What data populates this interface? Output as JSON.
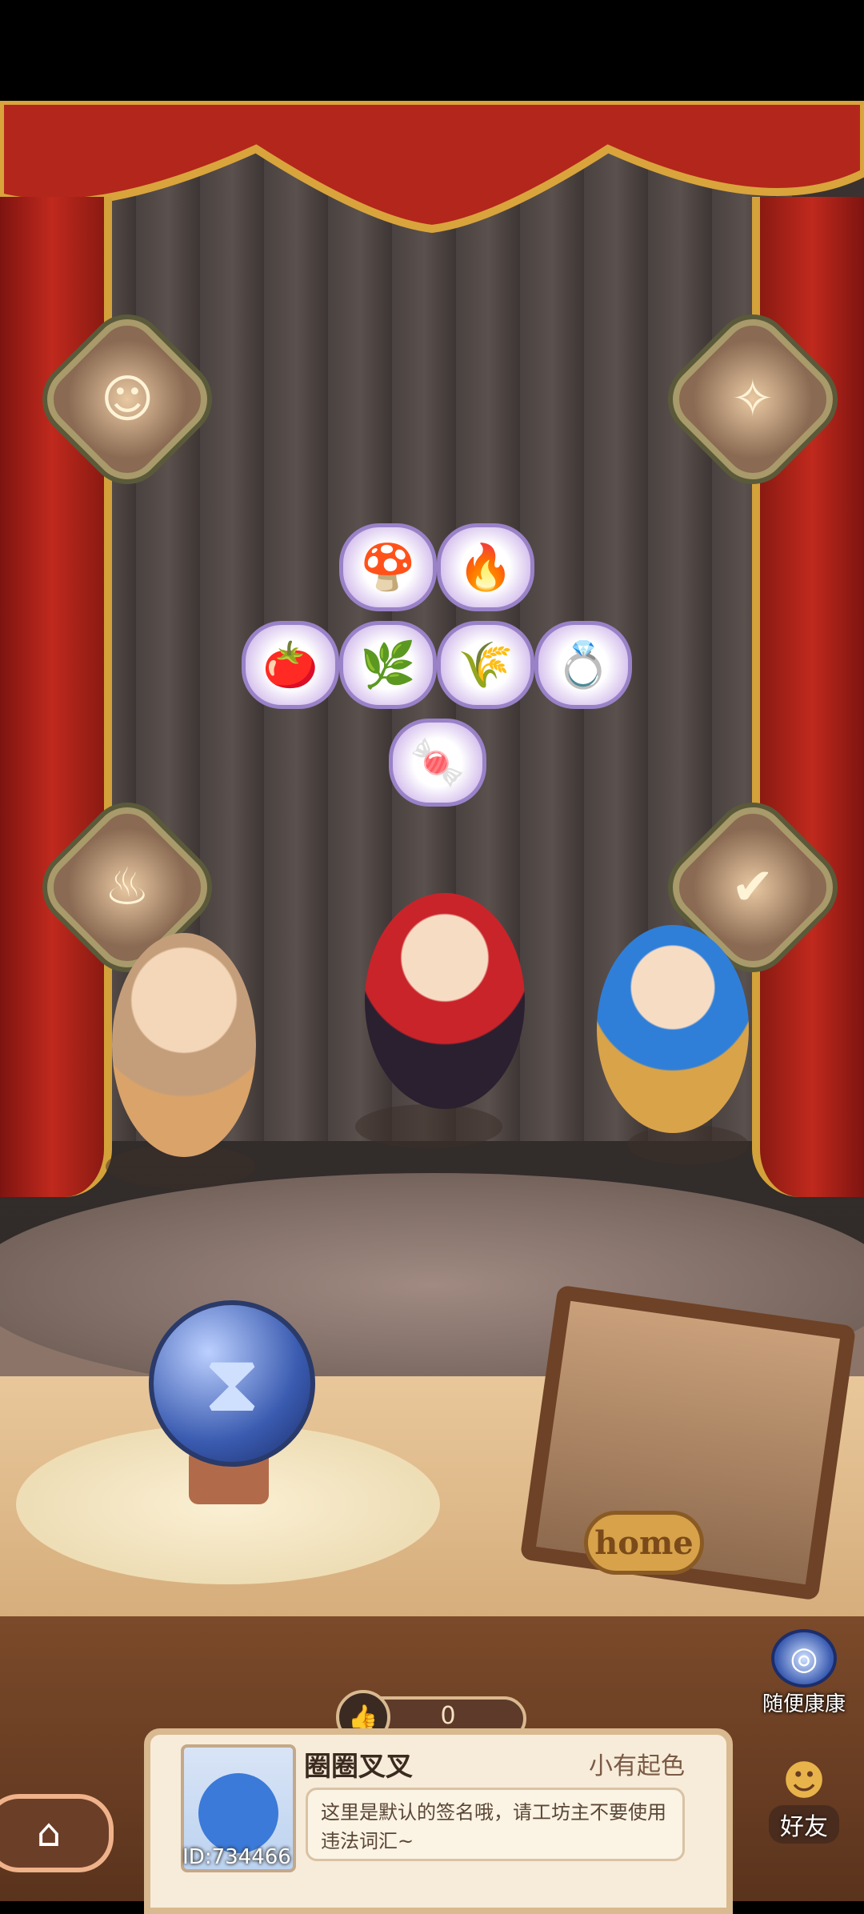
{
  "stage": {
    "medals": [
      {
        "icon": "mask-icon"
      },
      {
        "icon": "fairy-icon"
      },
      {
        "icon": "cauldron-icon"
      },
      {
        "icon": "scroll-icon"
      }
    ],
    "ingredients": [
      {
        "icon": "mushroom-pile-icon"
      },
      {
        "icon": "fire-ore-icon"
      },
      {
        "icon": "tomato-icon"
      },
      {
        "icon": "leek-icon"
      },
      {
        "icon": "golden-wheat-icon"
      },
      {
        "icon": "jade-ring-icon"
      },
      {
        "icon": "candy-strip-icon"
      }
    ]
  },
  "home_sign": {
    "label": "home"
  },
  "random_visit": {
    "label": "随便康康",
    "icon": "portal-icon"
  },
  "friends": {
    "label": "好友",
    "icon": "friends-icon"
  },
  "home_button": {
    "icon": "house-icon"
  },
  "profile": {
    "likes": "0",
    "name": "圈圈叉叉",
    "rank": "小有起色",
    "id_text": "ID:734466",
    "signature": "这里是默认的签名哦，请工坊主不要使用违法词汇~"
  }
}
